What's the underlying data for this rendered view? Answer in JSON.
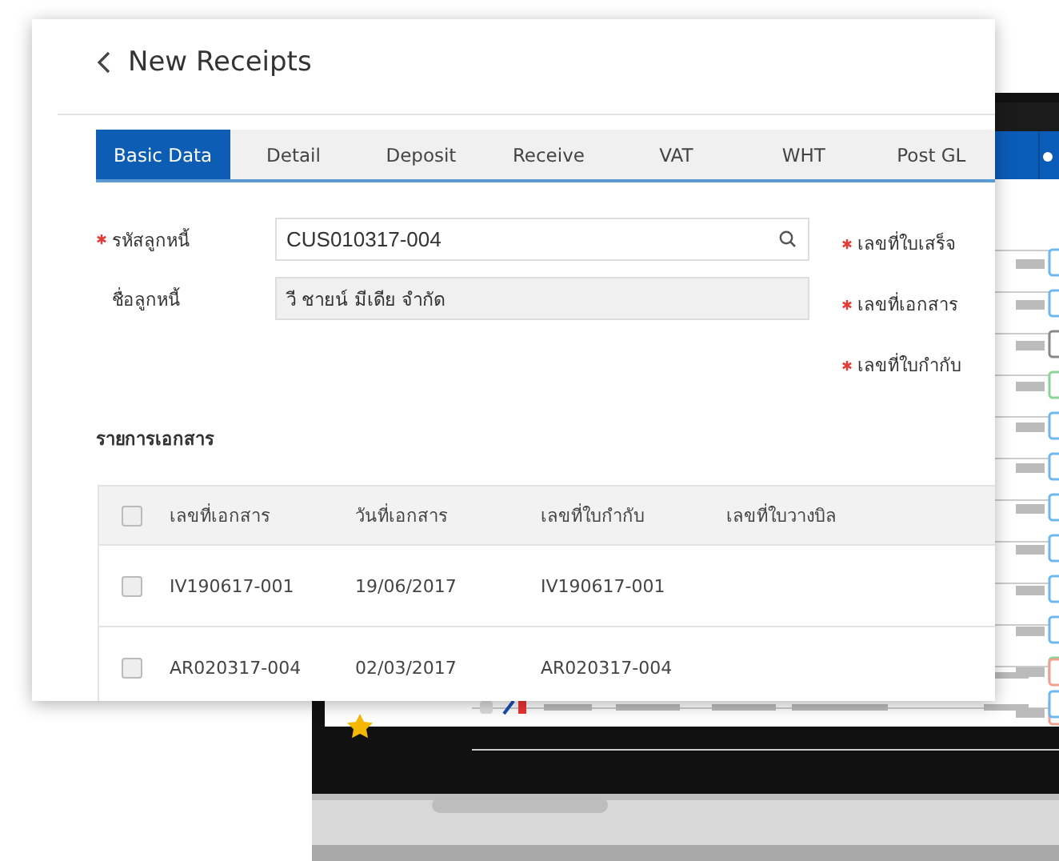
{
  "page": {
    "title": "New Receipts"
  },
  "tabs": [
    {
      "label": "Basic Data",
      "selected": true
    },
    {
      "label": "Detail",
      "selected": false
    },
    {
      "label": "Deposit",
      "selected": false
    },
    {
      "label": "Receive",
      "selected": false
    },
    {
      "label": "VAT",
      "selected": false
    },
    {
      "label": "WHT",
      "selected": false
    },
    {
      "label": "Post GL",
      "selected": false
    }
  ],
  "fields": [
    {
      "label": "รหัสลูกหนี้",
      "required": true,
      "kind": "search",
      "value": "CUS010317-004"
    },
    {
      "label": "ชื่อลูกหนี้",
      "required": false,
      "kind": "readonly",
      "value": "วี ชายน์ มีเดีย จำกัด"
    }
  ],
  "side_fields": [
    {
      "label": "เลขที่ใบเสร็จ",
      "required": true
    },
    {
      "label": "เลขที่เอกสาร",
      "required": true
    },
    {
      "label": "เลขที่ใบกำกับ",
      "required": true
    }
  ],
  "section_title": "รายการเอกสาร",
  "table": {
    "all_checked": false,
    "columns": [
      "เลขที่เอกสาร",
      "วันที่เอกสาร",
      "เลขที่ใบกำกับ",
      "เลขที่ใบวางบิล"
    ],
    "rows": [
      {
        "checked": false,
        "cells": [
          "IV190617-001",
          "19/06/2017",
          "IV190617-001"
        ]
      },
      {
        "checked": false,
        "cells": [
          "AR020317-004",
          "02/03/2017",
          "AR020317-004"
        ]
      }
    ]
  }
}
